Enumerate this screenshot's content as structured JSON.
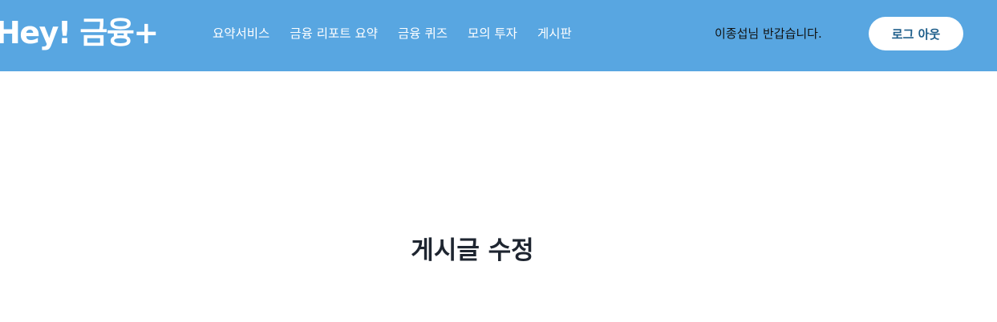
{
  "header": {
    "logo_text": "Hey! 금융+",
    "nav": [
      {
        "label": "요약서비스"
      },
      {
        "label": "금융 리포트 요약"
      },
      {
        "label": "금융 퀴즈"
      },
      {
        "label": "모의 투자"
      },
      {
        "label": "게시판"
      }
    ],
    "greeting": "이종섭님 반갑습니다.",
    "logout_label": "로그 아웃"
  },
  "main": {
    "title": "게시글 수정"
  },
  "colors": {
    "header_bg": "#58a6e1",
    "logout_text": "#1f5f8b",
    "title_text": "#1e2530"
  }
}
